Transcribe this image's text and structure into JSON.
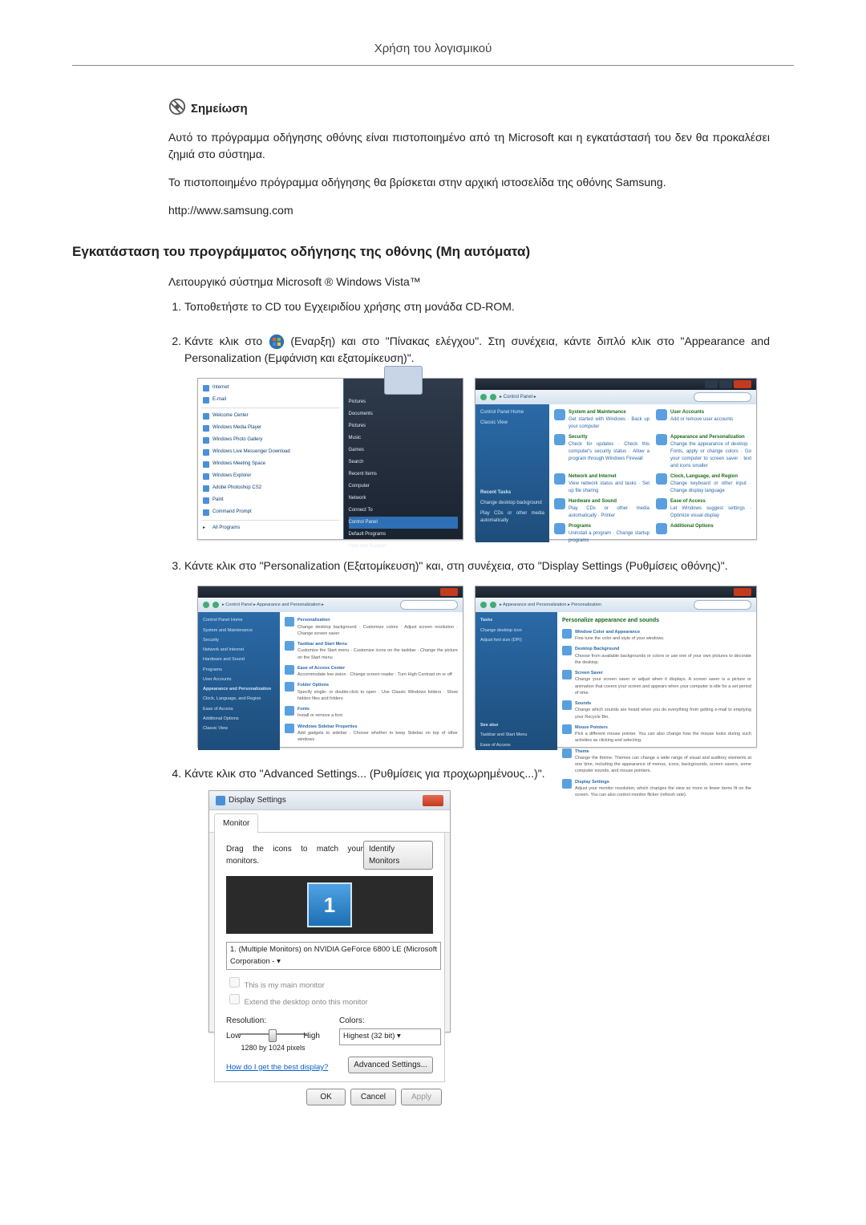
{
  "header": "Χρήση του λογισμικού",
  "note": {
    "label": "Σημείωση",
    "p1": "Αυτό το πρόγραμμα οδήγησης οθόνης είναι πιστοποιημένο από τη Microsoft και η εγκατάστασή του δεν θα προκαλέσει ζημιά στο σύστημα.",
    "p2": "Το πιστοποιημένο πρόγραμμα οδήγησης θα βρίσκεται στην αρχική ιστοσελίδα της οθόνης Samsung.",
    "url": "http://www.samsung.com"
  },
  "section_title": "Εγκατάσταση του προγράμματος οδήγησης της οθόνης (Μη αυτόματα)",
  "intro": "Λειτουργικό σύστημα Microsoft ® Windows Vista™",
  "steps": {
    "s1": "Τοποθετήστε το CD του Εγχειριδίου χρήσης στη μονάδα CD-ROM.",
    "s2a": "Κάντε κλικ στο ",
    "s2b": " (Εναρξη) και στο \"Πίνακας ελέγχου\". Στη συνέχεια, κάντε διπλό κλικ στο \"Appearance and Personalization (Εμφάνιση και εξατομίκευση)\".",
    "s3": "Κάντε κλικ στο \"Personalization (Εξατομίκευση)\" και, στη συνέχεια, στο \"Display Settings (Ρυθμίσεις οθόνης)\".",
    "s4": "Κάντε κλικ στο \"Advanced Settings... (Ρυθμίσεις για προχωρημένους...)\"."
  },
  "startmenu": {
    "left": [
      "Internet",
      "E-mail",
      "Welcome Center",
      "Windows Media Player",
      "Windows Photo Gallery",
      "Windows Live Messenger Download",
      "Windows Meeting Space",
      "Windows Explorer",
      "Adobe Photoshop CS2",
      "Paint",
      "Command Prompt",
      "All Programs"
    ],
    "right": [
      "Pictures",
      "Documents",
      "Pictures",
      "Music",
      "Games",
      "Search",
      "Recent Items",
      "Computer",
      "Network",
      "Connect To",
      "Control Panel",
      "Default Programs",
      "Help and Support"
    ]
  },
  "controlpanel": {
    "breadcrumb": "▸ Control Panel ▸",
    "side": [
      "Control Panel Home",
      "Classic View"
    ],
    "side_tasks": "Recent Tasks",
    "side_t1": "Change desktop background",
    "side_t2": "Play CDs or other media automatically",
    "cats": [
      {
        "t1": "System and Maintenance",
        "t2": "Get started with Windows · Back up your computer"
      },
      {
        "t1": "User Accounts",
        "t2": "Add or remove user accounts"
      },
      {
        "t1": "Security",
        "t2": "Check for updates · Check this computer's security status · Allow a program through Windows Firewall"
      },
      {
        "t1": "Appearance and Personalization",
        "t2": "Change the appearance of desktop · Fonts, apply or change colors · Go your computer to screen saver · text and icons smaller"
      },
      {
        "t1": "Network and Internet",
        "t2": "View network status and tasks · Set up file sharing"
      },
      {
        "t1": "Clock, Language, and Region",
        "t2": "Change keyboard or other input · Change display language"
      },
      {
        "t1": "Hardware and Sound",
        "t2": "Play CDs or other media automatically · Printer"
      },
      {
        "t1": "Ease of Access",
        "t2": "Let Windows suggest settings · Optimize visual display"
      },
      {
        "t1": "Programs",
        "t2": "Uninstall a program · Change startup programs"
      },
      {
        "t1": "Additional Options",
        "t2": ""
      }
    ]
  },
  "pers_a": {
    "breadcrumb": "▸ Control Panel ▸ Appearance and Personalization ▸",
    "side": [
      "Control Panel Home",
      "System and Maintenance",
      "Security",
      "Network and Internet",
      "Hardware and Sound",
      "Programs",
      "User Accounts",
      "Appearance and Personalization",
      "Clock, Language, and Region",
      "Ease of Access",
      "Additional Options",
      "",
      "Classic View"
    ],
    "items": [
      {
        "t1": "Personalization",
        "t2": "Change desktop background · Customize colors · Adjust screen resolution · Change screen saver"
      },
      {
        "t1": "Taskbar and Start Menu",
        "t2": "Customize the Start menu · Customize icons on the taskbar · Change the picture on the Start menu"
      },
      {
        "t1": "Ease of Access Center",
        "t2": "Accommodate low vision · Change screen reader · Turn High Contrast on or off"
      },
      {
        "t1": "Folder Options",
        "t2": "Specify single- or double-click to open · Use Classic Windows folders · Show hidden files and folders"
      },
      {
        "t1": "Fonts",
        "t2": "Install or remove a font"
      },
      {
        "t1": "Windows Sidebar Properties",
        "t2": "Add gadgets to sidebar · Choose whether to keep Sidebar on top of other windows"
      }
    ]
  },
  "pers_b": {
    "breadcrumb": "▸ Appearance and Personalization ▸ Personalization",
    "title": "Personalize appearance and sounds",
    "side": [
      "Tasks",
      "Change desktop icon",
      "Adjust font size (DPI)"
    ],
    "items": [
      {
        "t1": "Window Color and Appearance",
        "t2": "Fine tune the color and style of your windows."
      },
      {
        "t1": "Desktop Background",
        "t2": "Choose from available backgrounds or colors or use one of your own pictures to decorate the desktop."
      },
      {
        "t1": "Screen Saver",
        "t2": "Change your screen saver or adjust when it displays. A screen saver is a picture or animation that covers your screen and appears when your computer is idle for a set period of time."
      },
      {
        "t1": "Sounds",
        "t2": "Change which sounds are heard when you do everything from getting e-mail to emptying your Recycle Bin."
      },
      {
        "t1": "Mouse Pointers",
        "t2": "Pick a different mouse pointer. You can also change how the mouse looks during such activities as clicking and selecting."
      },
      {
        "t1": "Theme",
        "t2": "Change the theme. Themes can change a wide range of visual and auditory elements at one time, including the appearance of menus, icons, backgrounds, screen savers, some computer sounds, and mouse pointers."
      },
      {
        "t1": "Display Settings",
        "t2": "Adjust your monitor resolution, which changes the view so more or fewer items fit on the screen. You can also control monitor flicker (refresh rate)."
      }
    ]
  },
  "ds": {
    "title": "Display Settings",
    "tab": "Monitor",
    "drag": "Drag the icons to match your monitors.",
    "identify": "Identify Monitors",
    "mon_num": "1",
    "select": "1. (Multiple Monitors) on NVIDIA GeForce 6800 LE (Microsoft Corporation - ▾",
    "chk1": "This is my main monitor",
    "chk2": "Extend the desktop onto this monitor",
    "res_label": "Resolution:",
    "low": "Low",
    "high": "High",
    "res_val": "1280 by 1024 pixels",
    "col_label": "Colors:",
    "col_val": "Highest (32 bit)    ▾",
    "link": "How do I get the best display?",
    "adv": "Advanced Settings...",
    "ok": "OK",
    "cancel": "Cancel",
    "apply": "Apply"
  }
}
